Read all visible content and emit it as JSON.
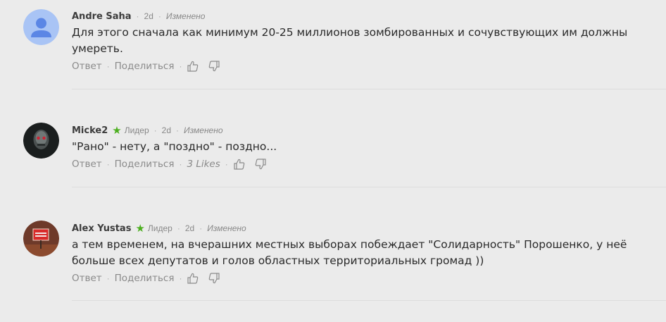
{
  "comments": [
    {
      "author": "Andre Saha",
      "rank": "",
      "time": "2d",
      "edited": "Изменено",
      "text": "Для этого сначала как минимум 20-25 миллионов зомбированных и сочувствующих им должны умереть.",
      "reply_label": "Ответ",
      "share_label": "Поделиться",
      "likes": ""
    },
    {
      "author": "Micke2",
      "rank": "Лидер",
      "time": "2d",
      "edited": "Изменено",
      "text": "\"Рано\" - нету, а \"поздно\" - поздно...",
      "reply_label": "Ответ",
      "share_label": "Поделиться",
      "likes": "3 Likes"
    },
    {
      "author": "Alex Yustas",
      "rank": "Лидер",
      "time": "2d",
      "edited": "Изменено",
      "text": "а тем временем, на вчерашних местных выборах побеждает \"Солидарность\" Порошенко, у неё больше всех депутатов и голов областных  территориальных громад ))",
      "reply_label": "Ответ",
      "share_label": "Поделиться",
      "likes": ""
    }
  ],
  "icons": {
    "leader": "star-icon",
    "upvote": "thumbs-up-icon",
    "downvote": "thumbs-down-icon"
  },
  "colors": {
    "leader_star": "#4caf1f",
    "default_avatar": "#a9c4f5"
  }
}
